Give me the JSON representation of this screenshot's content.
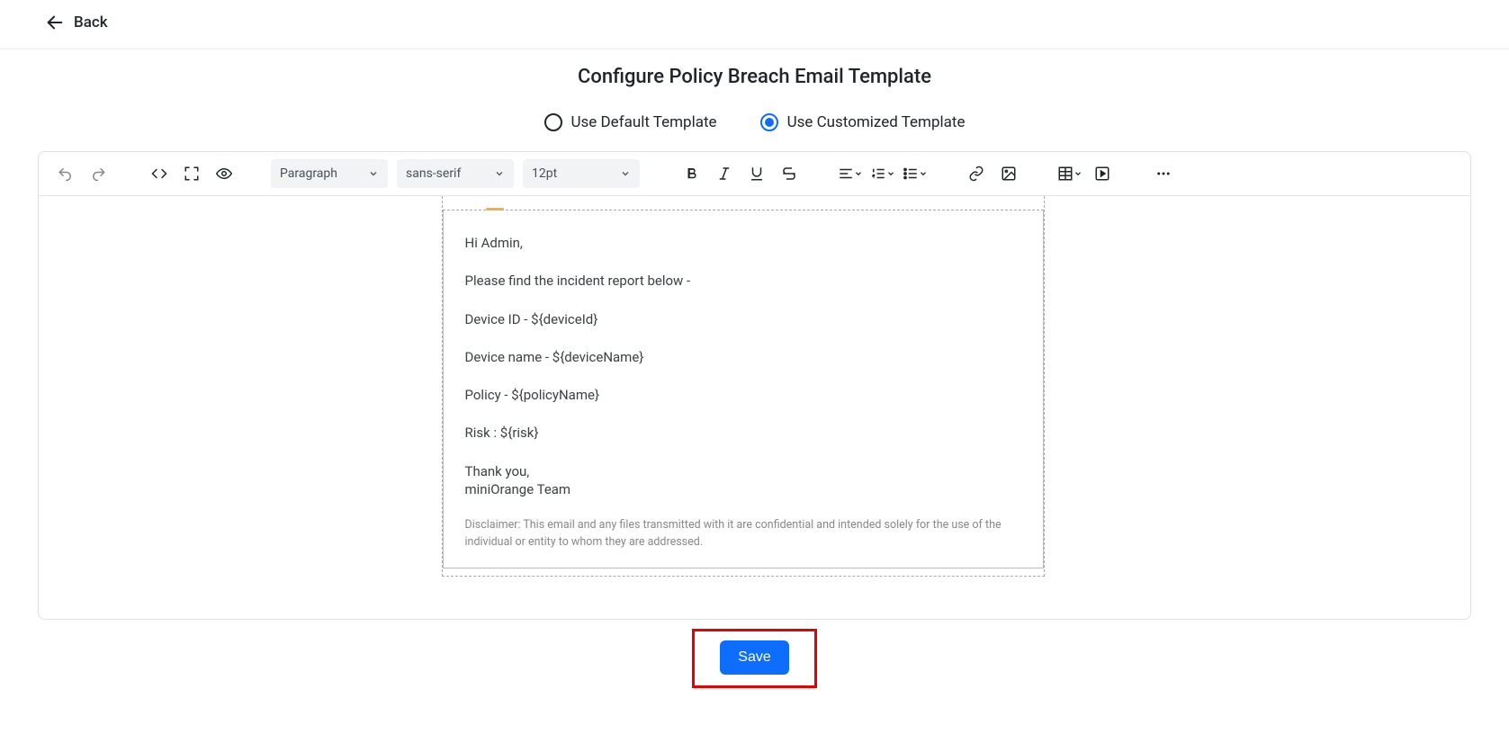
{
  "header": {
    "back_label": "Back"
  },
  "title": "Configure Policy Breach Email Template",
  "template_options": {
    "default_label": "Use Default Template",
    "custom_label": "Use Customized Template"
  },
  "toolbar": {
    "block_format": "Paragraph",
    "font_family": "sans-serif",
    "font_size": "12pt"
  },
  "email": {
    "greeting": "Hi Admin,",
    "intro": "Please find the incident report below -",
    "fields": {
      "device_id": "Device ID - ${deviceId}",
      "device_name": "Device name - ${deviceName}",
      "policy": "Policy - ${policyName}",
      "risk": "Risk : ${risk}"
    },
    "closing_thanks": "Thank you,",
    "closing_team": "miniOrange Team",
    "disclaimer": "Disclaimer: This email and any files transmitted with it are confidential and intended solely for the use of the individual or entity to whom they are addressed."
  },
  "actions": {
    "save_label": "Save"
  }
}
